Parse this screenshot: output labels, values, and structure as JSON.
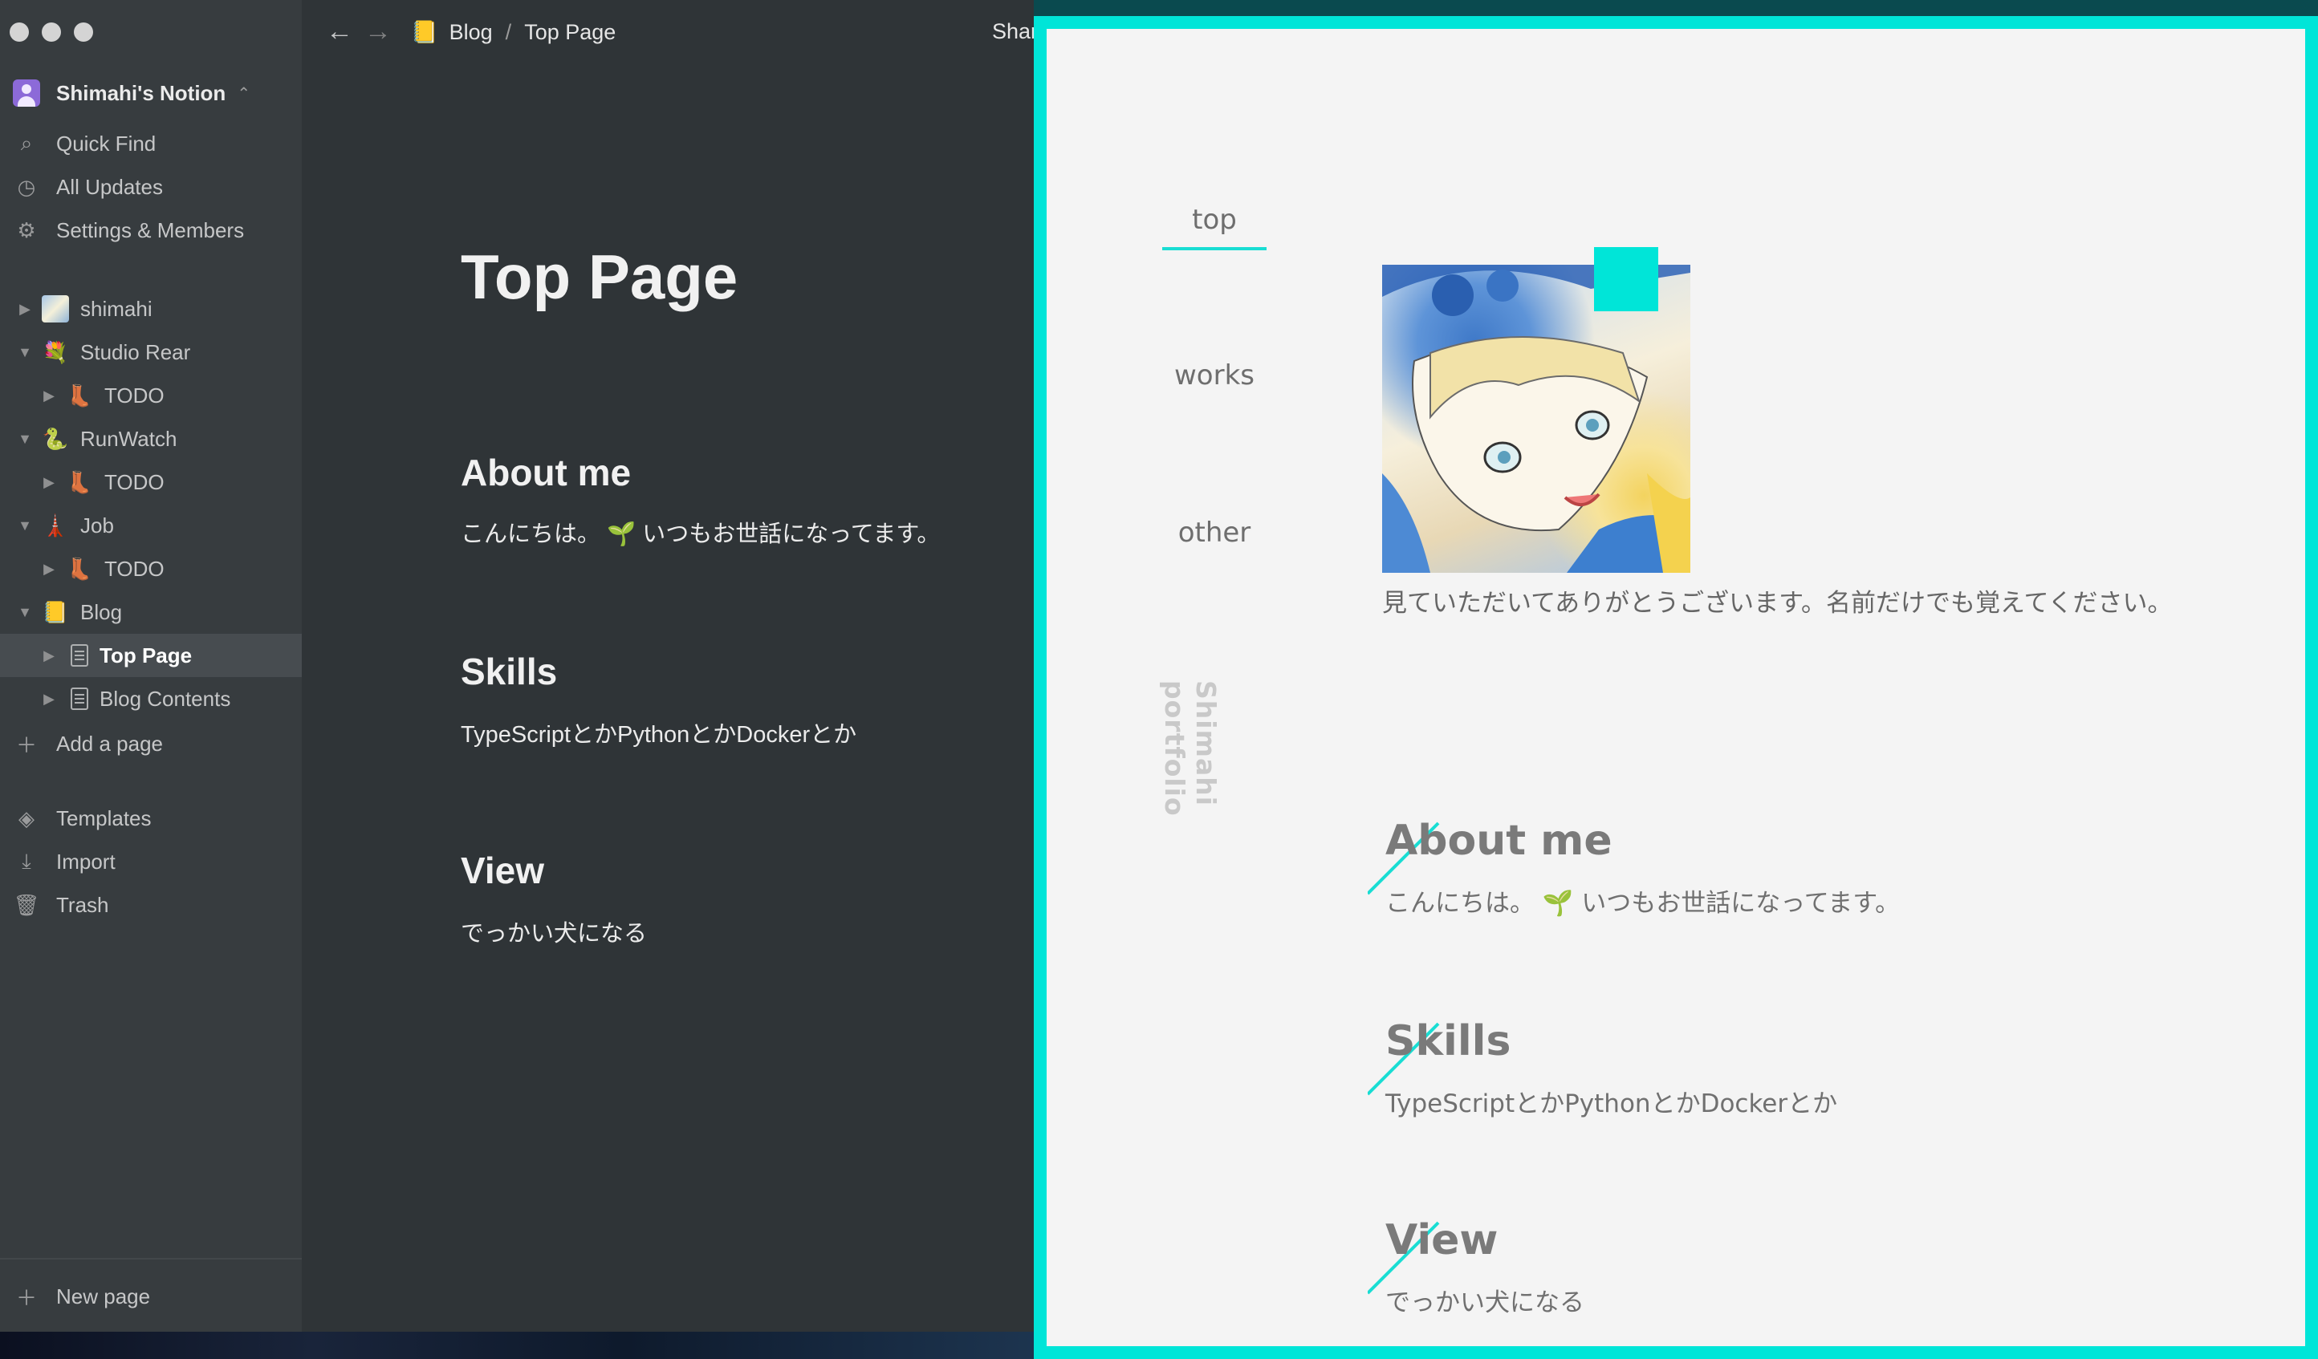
{
  "notion": {
    "workspace": {
      "name": "Shimahi's Notion",
      "switch_icon": "⌃⌄"
    },
    "sidebar_actions": [
      {
        "name": "quick-find",
        "label": "Quick Find",
        "icon": "search-icon"
      },
      {
        "name": "all-updates",
        "label": "All Updates",
        "icon": "clock-icon"
      },
      {
        "name": "settings-members",
        "label": "Settings & Members",
        "icon": "gear-icon"
      }
    ],
    "pages": [
      {
        "label": "shimahi",
        "emoji": "",
        "level": 0,
        "toggle": "▶",
        "thumb": true
      },
      {
        "label": "Studio Rear",
        "emoji": "💐",
        "level": 0,
        "toggle": "▼"
      },
      {
        "label": "TODO",
        "emoji": "👢",
        "level": 1,
        "toggle": "▶"
      },
      {
        "label": "RunWatch",
        "emoji": "🐍",
        "level": 0,
        "toggle": "▼"
      },
      {
        "label": "TODO",
        "emoji": "👢",
        "level": 1,
        "toggle": "▶"
      },
      {
        "label": "Job",
        "emoji": "🗼",
        "level": 0,
        "toggle": "▼"
      },
      {
        "label": "TODO",
        "emoji": "👢",
        "level": 1,
        "toggle": "▶"
      },
      {
        "label": "Blog",
        "emoji": "📒",
        "level": 0,
        "toggle": "▼"
      },
      {
        "label": "Top Page",
        "emoji": "",
        "level": 1,
        "toggle": "▶",
        "doc": true,
        "active": true
      },
      {
        "label": "Blog Contents",
        "emoji": "",
        "level": 1,
        "toggle": "▶",
        "doc": true
      }
    ],
    "add_page": "Add a page",
    "bottom_actions": [
      {
        "name": "templates",
        "label": "Templates",
        "icon": "templates-icon"
      },
      {
        "name": "import",
        "label": "Import",
        "icon": "download-icon"
      },
      {
        "name": "trash",
        "label": "Trash",
        "icon": "trash-icon"
      }
    ],
    "new_page": "New page",
    "breadcrumb": {
      "parent": "Blog",
      "parent_emoji": "📒",
      "separator": "/",
      "current": "Top Page"
    },
    "share_label": "Shar",
    "content": {
      "title": "Top Page",
      "sections": [
        {
          "heading": "About me",
          "text": "こんにちは。 🌱 いつもお世話になってます。"
        },
        {
          "heading": "Skills",
          "text": "TypeScriptとかPythonとかDockerとか"
        },
        {
          "heading": "View",
          "text": "でっかい犬になる"
        }
      ]
    }
  },
  "preview": {
    "accent_color": "#00e5d8",
    "nav": {
      "top": "top",
      "works": "works",
      "other": "other"
    },
    "vertical_label": "Shimahi portfolio",
    "intro": "見ていただいてありがとうございます。名前だけでも覚えてください。",
    "sections": [
      {
        "heading": "About me",
        "text": "こんにちは。 🌱 いつもお世話になってます。"
      },
      {
        "heading": "Skills",
        "text": "TypeScriptとかPythonとかDockerとか"
      },
      {
        "heading": "View",
        "text": "でっかい犬になる"
      }
    ]
  }
}
